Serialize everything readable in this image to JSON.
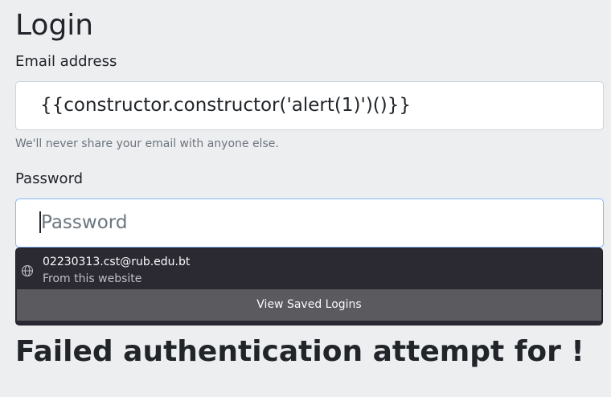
{
  "page": {
    "title": "Login",
    "message": "Failed authentication attempt for !"
  },
  "form": {
    "email_label": "Email address",
    "email_value": "{{constructor.constructor('alert(1)')()}}",
    "email_help": "We'll never share your email with anyone else.",
    "password_label": "Password",
    "password_placeholder": "Password"
  },
  "autocomplete": {
    "icon": "globe-icon",
    "saved_login": "02230313.cst@rub.edu.bt",
    "source": "From this website",
    "footer_label": "View Saved Logins"
  }
}
